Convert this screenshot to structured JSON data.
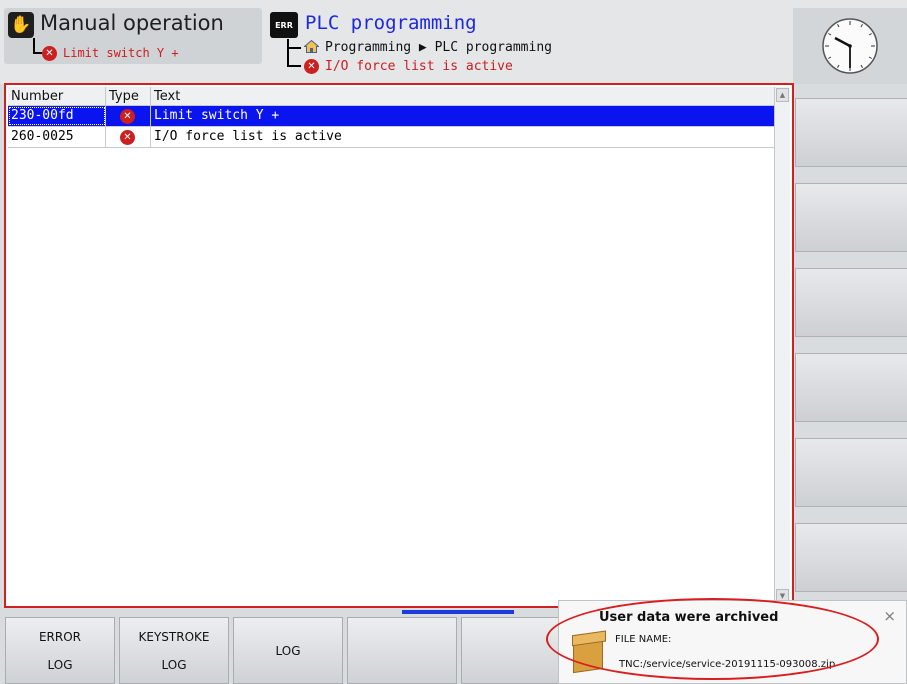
{
  "header": {
    "mode_title": "Manual operation",
    "mode_error": "Limit switch Y +",
    "err_badge": "ERR",
    "program_title": "PLC programming",
    "breadcrumb": "Programming ▶ PLC programming",
    "program_error": "I/O force list is active"
  },
  "table": {
    "headers": {
      "number": "Number",
      "type": "Type",
      "text": "Text"
    },
    "rows": [
      {
        "number": "230-00fd",
        "text": "Limit switch Y +",
        "selected": true
      },
      {
        "number": "260-0025",
        "text": "I/O force list is active",
        "selected": false
      }
    ]
  },
  "softkeys": [
    {
      "line1": "ERROR",
      "line2": "LOG"
    },
    {
      "line1": "KEYSTROKE",
      "line2": "LOG"
    },
    {
      "line1": "LOG",
      "line2": ""
    },
    {
      "line1": "",
      "line2": ""
    },
    {
      "line1": "",
      "line2": ""
    }
  ],
  "notification": {
    "title": "User data were archived",
    "label": "FILE NAME:",
    "filename": "TNC:/service/service-20191115-093008.zip",
    "close": "×"
  },
  "colors": {
    "error_red": "#cc2020",
    "selection_blue": "#0a14ee",
    "title_blue": "#1e28dc",
    "frame_red": "#d02020"
  },
  "icons": [
    "hand-icon",
    "error-icon",
    "err-badge-icon",
    "home-icon",
    "clock-icon",
    "archive-box-icon",
    "close-icon"
  ]
}
